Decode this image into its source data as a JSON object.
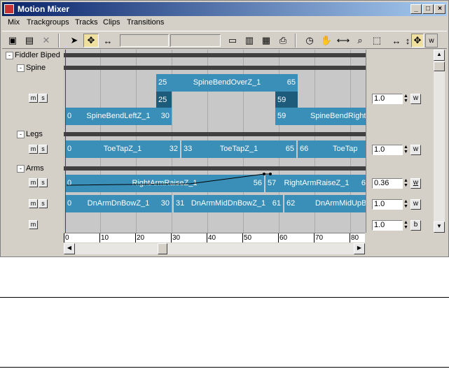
{
  "window": {
    "title": "Motion Mixer",
    "controls": [
      "_",
      "□",
      "×"
    ]
  },
  "menu": [
    "Mix",
    "Trackgroups",
    "Tracks",
    "Clips",
    "Transitions"
  ],
  "toolbar": {
    "icons": [
      "snapshot-icon",
      "film-icon",
      "delete-x-icon",
      "pointer-arrow-icon",
      "move-icon",
      "scale-range-icon",
      "track-icon",
      "edit-icon",
      "film-boundary-icon",
      "print-icon",
      "clock-icon",
      "hand-pan-icon",
      "zoom-range-icon",
      "zoom-icon",
      "zoom-region-icon",
      "arrows-horizontal-icon",
      "arrows-vertical-icon",
      "move-small-icon",
      "w-icon"
    ]
  },
  "biped": {
    "label": "Fiddler Biped",
    "toggle": "-"
  },
  "groups": [
    {
      "label": "Spine",
      "toggle": "-"
    },
    {
      "label": "Legs",
      "toggle": "-"
    },
    {
      "label": "Arms",
      "toggle": "-"
    }
  ],
  "tracks": {
    "spine": {
      "m": "m",
      "s": "s",
      "weight": "1.0",
      "w": "w"
    },
    "legs": {
      "m": "m",
      "s": "s",
      "weight": "1.0",
      "w": "w"
    },
    "arms1": {
      "m": "m",
      "s": "s",
      "weight": "0.36",
      "w": "w"
    },
    "arms2": {
      "m": "m",
      "s": "s",
      "weight": "1.0",
      "w": "w"
    },
    "bottom": {
      "m": "m",
      "weight": "1.0",
      "b": "b"
    }
  },
  "clips": {
    "spine_top": {
      "start": "25",
      "name": "SpineBendOverZ_1",
      "end": "65"
    },
    "spine_mid_a": {
      "start": "25"
    },
    "spine_mid_b": {
      "start": "59"
    },
    "spine_left": {
      "start": "0",
      "name": "SpineBendLeftZ_1",
      "end": "30"
    },
    "spine_right": {
      "start": "59",
      "name": "SpineBendRight"
    },
    "legs_1": {
      "start": "0",
      "name": "ToeTapZ_1",
      "end": "32"
    },
    "legs_2": {
      "start": "33",
      "name": "ToeTapZ_1",
      "end": "65"
    },
    "legs_3": {
      "start": "66",
      "name": "ToeTap"
    },
    "arms_1": {
      "start": "0",
      "name": "RightArmRaiseZ_1",
      "end": "56"
    },
    "arms_2": {
      "start": "57",
      "name": "RightArmRaiseZ_1",
      "end": "6"
    },
    "arms2_1": {
      "start": "0",
      "name": "DnArmDnBowZ_1",
      "end": "30"
    },
    "arms2_2": {
      "start": "31",
      "name": "DnArmMidDnBowZ_1",
      "end": "61"
    },
    "arms2_3": {
      "start": "62",
      "name": "DnArmMidUpBo"
    }
  },
  "ruler": [
    "0",
    "10",
    "20",
    "30",
    "40",
    "50",
    "60",
    "70",
    "80"
  ],
  "colors": {
    "clip": "#3a8fb8",
    "clip_dark": "#1e5a7a",
    "titlebar": "#0a246a"
  }
}
